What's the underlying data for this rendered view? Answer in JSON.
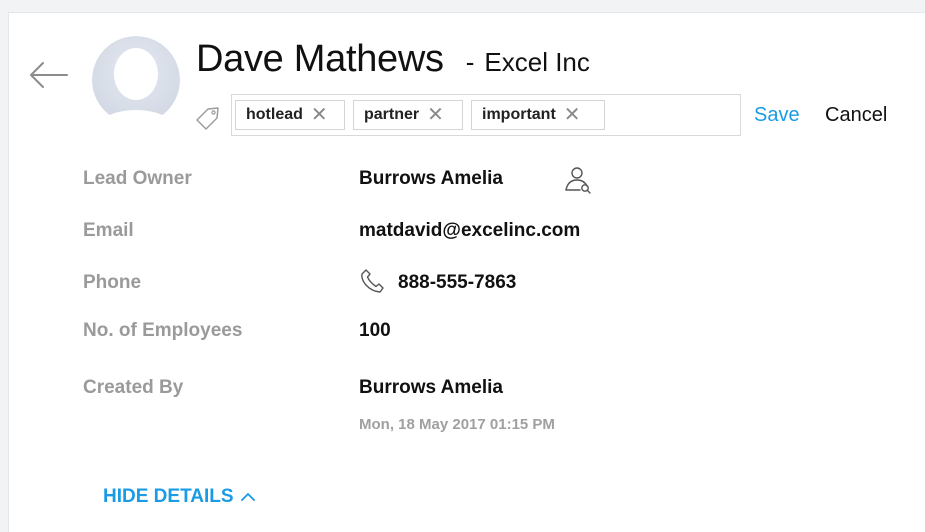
{
  "header": {
    "name": "Dave Mathews",
    "separator": "-",
    "company": "Excel Inc"
  },
  "tags": [
    {
      "label": "hotlead"
    },
    {
      "label": "partner"
    },
    {
      "label": "important"
    }
  ],
  "actions": {
    "save_label": "Save",
    "cancel_label": "Cancel"
  },
  "fields": {
    "lead_owner": {
      "label": "Lead Owner",
      "value": "Burrows Amelia"
    },
    "email": {
      "label": "Email",
      "value": "matdavid@excelinc.com"
    },
    "phone": {
      "label": "Phone",
      "value": "888-555-7863"
    },
    "employees": {
      "label": "No. of Employees",
      "value": "100"
    },
    "created_by": {
      "label": "Created By",
      "value": "Burrows Amelia",
      "timestamp": "Mon, 18 May 2017 01:15 PM"
    }
  },
  "footer": {
    "toggle_label": "HIDE DETAILS"
  },
  "icons": {
    "back": "arrow-left-icon",
    "avatar": "avatar-placeholder",
    "tag": "tag-icon",
    "tag_remove": "close-icon",
    "owner": "user-search-icon",
    "phone": "phone-icon",
    "toggle": "chevron-up-icon"
  },
  "colors": {
    "accent": "#1a9be6",
    "label": "#9a9a9a",
    "avatar": "#dde3ee"
  }
}
